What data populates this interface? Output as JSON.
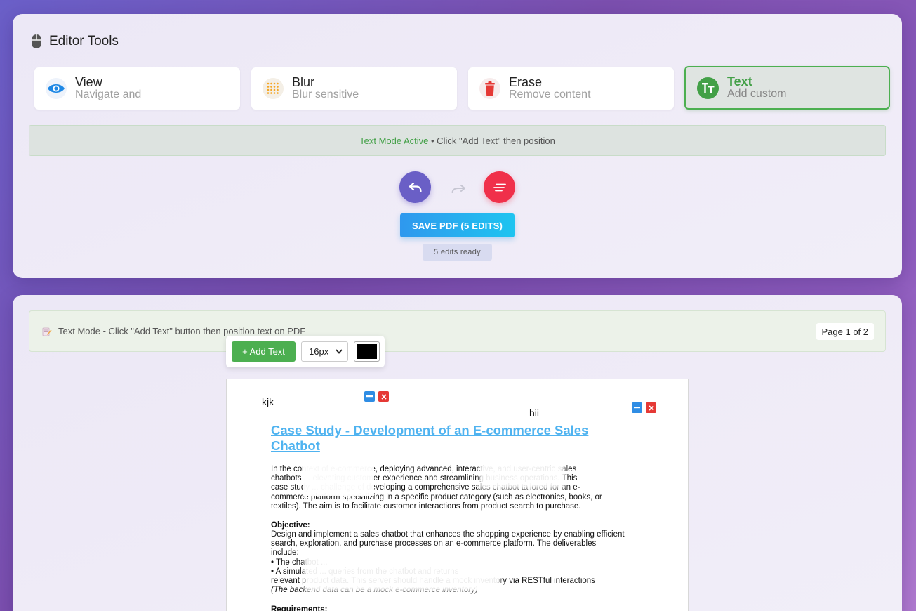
{
  "tools": {
    "title": "Editor Tools",
    "cards": [
      {
        "name": "View",
        "desc": "Navigate and",
        "icon": "eye-icon",
        "color": "#1e88e5"
      },
      {
        "name": "Blur",
        "desc": "Blur sensitive",
        "icon": "blur-grid-icon",
        "color": "#f5a623"
      },
      {
        "name": "Erase",
        "desc": "Remove content",
        "icon": "trash-icon",
        "color": "#e53935"
      },
      {
        "name": "Text",
        "desc": "Add custom",
        "icon": "text-tt-icon",
        "color": "#43a047",
        "active": true
      }
    ],
    "mode_banner": {
      "highlight": "Text Mode Active",
      "rest": " • Click \"Add Text\" then position"
    },
    "save_label": "SAVE PDF (5 EDITS)",
    "edits_ready": "5 edits ready"
  },
  "viewer": {
    "bar_text": "Text Mode - Click \"Add Text\" button then position text on PDF",
    "page_indicator": "Page 1 of 2",
    "add_text_label": "+ Add Text",
    "font_size": "16px",
    "text_color": "#000000"
  },
  "pdf": {
    "overlay_1": "kjk",
    "overlay_2": "hii",
    "title": "Case Study - Development of an E-commerce Sales Chatbot",
    "intro": [
      "In the context of e-commerce, deploying advanced, interactive, and user-centric sales",
      "chatbots ... elevating customer experience and streamlining business operations. This",
      "case study ... challenge of developing a comprehensive sales chatbot tailored for an e-",
      "commerce platform specializing in a specific product category (such as electronics, books, or",
      "textiles). The aim is to facilitate customer interactions from product search to purchase."
    ],
    "objective_heading": "Objective:",
    "objective": [
      "Design and implement a sales chatbot that enhances the shopping experience by enabling efficient",
      "search, exploration, and purchase processes on an e-commerce platform. The deliverables",
      "include:",
      "• The chatbot ...",
      "• A simulated ... queries from the chatbot and returns",
      "relevant product data. This server should handle a mock inventory via RESTful interactions"
    ],
    "objective_note": "(The backend data can be a mock e-commerce inventory)",
    "requirements_heading": "Requirements:"
  }
}
